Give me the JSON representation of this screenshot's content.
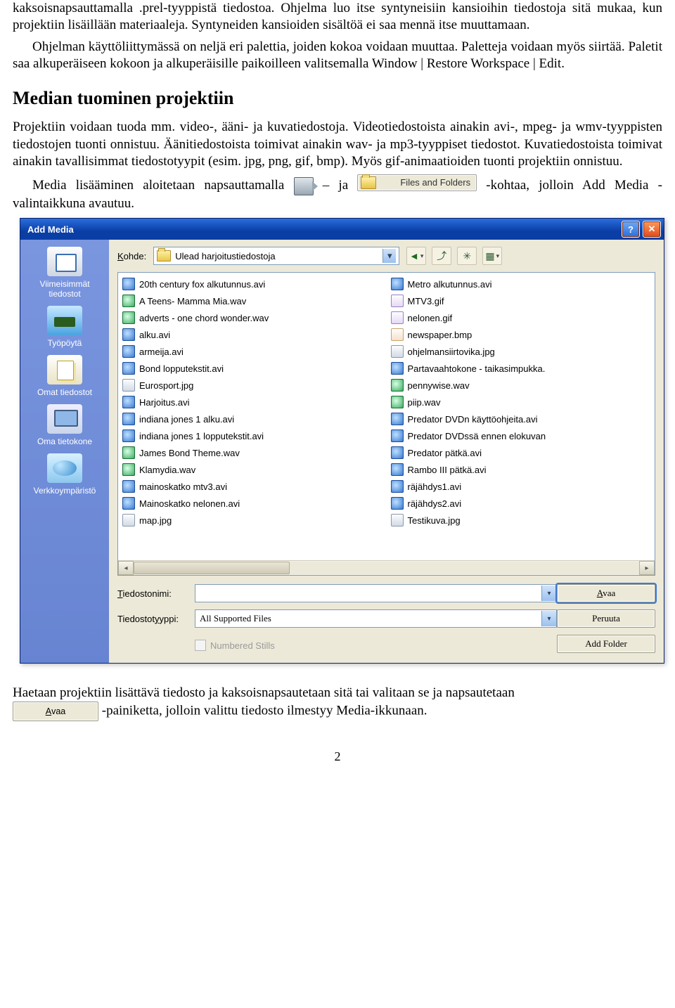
{
  "para1": "kaksoisnapsauttamalla .prel-tyyppistä tiedostoa. Ohjelma luo itse syntyneisiin kansioihin tiedostoja sitä mukaa, kun projektiin lisäillään materiaaleja. Syntyneiden kansioiden sisältöä ei saa mennä itse muuttamaan.",
  "para2": "Ohjelman käyttöliittymässä on neljä eri palettia, joiden kokoa voidaan muuttaa. Paletteja voidaan myös siirtää. Paletit saa alkuperäiseen kokoon ja alkuperäisille paikoilleen valitsemalla Window | Restore Workspace | Edit.",
  "heading": "Median tuominen projektiin",
  "para3": "Projektiin voidaan tuoda mm. video-, ääni- ja kuvatiedostoja. Videotiedostoista ainakin avi-, mpeg- ja wmv-tyyppisten tiedostojen tuonti onnistuu. Äänitiedostoista toimivat ainakin wav- ja mp3-tyyppiset tiedostot. Kuvatiedostoista toimivat ainakin tavallisimmat tiedostotyypit (esim. jpg, png, gif, bmp). Myös gif-animaatioiden tuonti projektiin onnistuu.",
  "para4a": "Media lisääminen aloitetaan napsauttamalla ",
  "para4_ja": " – ja ",
  "folderBtnLabel": "Files and Folders",
  "para4b": "-kohtaa, jolloin Add Media -valintaikkuna avautuu.",
  "para5a": "Haetaan projektiin lisättävä tiedosto ja kaksoisnapsautetaan sitä tai valitaan se ja napsautetaan ",
  "para5b": "-painiketta, jolloin valittu tiedosto ilmestyy Media-ikkunaan.",
  "pageNumber": "2",
  "dialog": {
    "title": "Add Media",
    "kohdeLabel": "Kohde:",
    "kohdeValue": "Ulead harjoitustiedostoja",
    "places": {
      "recent": "Viimeisimmät tiedostot",
      "desktop": "Työpöytä",
      "mydocs": "Omat tiedostot",
      "computer": "Oma tietokone",
      "network": "Verkkoympäristö"
    },
    "filesLeft": [
      {
        "name": "20th century fox alkutunnus.avi",
        "t": "avi"
      },
      {
        "name": "A Teens- Mamma Mia.wav",
        "t": "wav"
      },
      {
        "name": "adverts - one chord wonder.wav",
        "t": "wav"
      },
      {
        "name": "alku.avi",
        "t": "avi"
      },
      {
        "name": "armeija.avi",
        "t": "avi"
      },
      {
        "name": "Bond lopputekstit.avi",
        "t": "avi"
      },
      {
        "name": "Eurosport.jpg",
        "t": "jpg"
      },
      {
        "name": "Harjoitus.avi",
        "t": "avi"
      },
      {
        "name": "indiana jones 1 alku.avi",
        "t": "avi"
      },
      {
        "name": "indiana jones 1 lopputekstit.avi",
        "t": "avi"
      },
      {
        "name": "James Bond Theme.wav",
        "t": "wav"
      },
      {
        "name": "Klamydia.wav",
        "t": "wav"
      },
      {
        "name": "mainoskatko mtv3.avi",
        "t": "avi"
      },
      {
        "name": "Mainoskatko nelonen.avi",
        "t": "avi"
      },
      {
        "name": "map.jpg",
        "t": "jpg"
      }
    ],
    "filesRight": [
      {
        "name": "Metro alkutunnus.avi",
        "t": "avi"
      },
      {
        "name": "MTV3.gif",
        "t": "gif"
      },
      {
        "name": "nelonen.gif",
        "t": "gif"
      },
      {
        "name": "newspaper.bmp",
        "t": "bmp"
      },
      {
        "name": "ohjelmansiirtovika.jpg",
        "t": "jpg"
      },
      {
        "name": "Partavaahtokone - taikasimpukka.",
        "t": "avi"
      },
      {
        "name": "pennywise.wav",
        "t": "wav"
      },
      {
        "name": "piip.wav",
        "t": "wav"
      },
      {
        "name": "Predator DVDn käyttöohjeita.avi",
        "t": "avi"
      },
      {
        "name": "Predator DVDssä ennen elokuvan",
        "t": "avi"
      },
      {
        "name": "Predator pätkä.avi",
        "t": "avi"
      },
      {
        "name": "Rambo III pätkä.avi",
        "t": "avi"
      },
      {
        "name": "räjähdys1.avi",
        "t": "avi"
      },
      {
        "name": "räjähdys2.avi",
        "t": "avi"
      },
      {
        "name": "Testikuva.jpg",
        "t": "jpg"
      }
    ],
    "filenameLabel": "Tiedostonimi:",
    "filenameValue": "",
    "filetypeLabel": "Tiedostotyyppi:",
    "filetypeValue": "All Supported Files",
    "numberedLabel": "Numbered Stills",
    "openBtn": "Avaa",
    "cancelBtn": "Peruuta",
    "addFolderBtn": "Add Folder"
  },
  "avaaBtnText": "Avaa"
}
